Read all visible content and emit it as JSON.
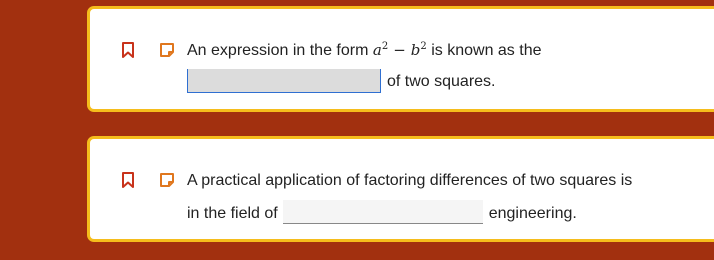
{
  "questions": [
    {
      "line1_prefix": "An expression in the form ",
      "math": {
        "a": "a",
        "exp_a": "2",
        "op": "−",
        "b": "b",
        "exp_b": "2"
      },
      "line1_suffix": " is known as the",
      "blank_value": "",
      "line2_suffix": "of two squares.",
      "icons": [
        "bookmark-icon",
        "note-icon"
      ]
    },
    {
      "line1": "A practical application of factoring differences of two squares is",
      "line2_prefix": "in the field of",
      "blank_value": "",
      "line2_suffix": "engineering.",
      "icons": [
        "bookmark-icon",
        "note-icon"
      ]
    }
  ],
  "colors": {
    "background": "#a2300f",
    "card_border": "#f5bd1c",
    "icon_red": "#c8331b",
    "icon_orange": "#e0771e",
    "active_blank_border": "#2f6fd1"
  }
}
